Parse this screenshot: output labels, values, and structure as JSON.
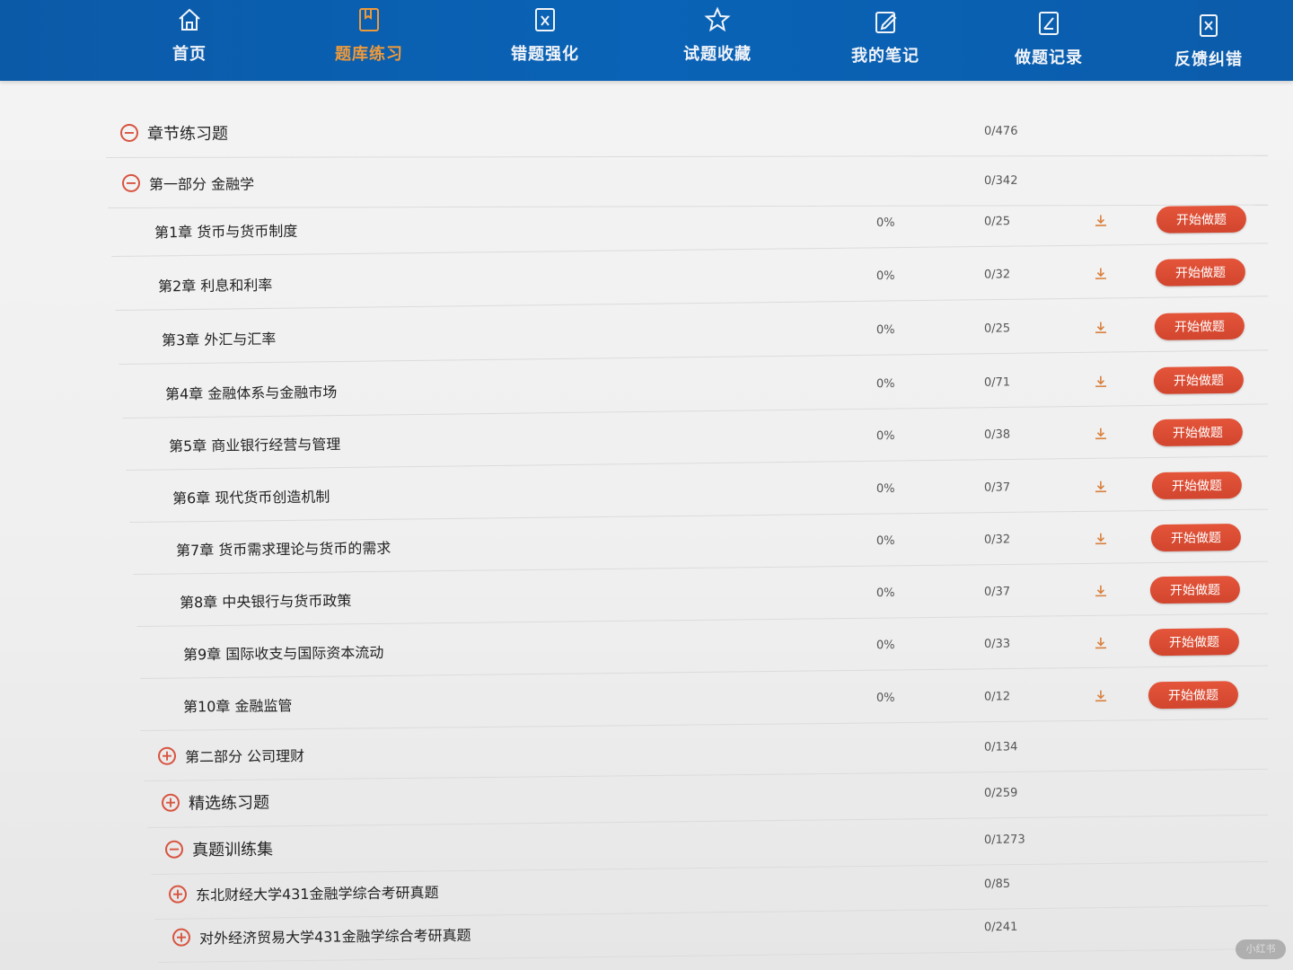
{
  "nav": [
    {
      "label": "首页",
      "icon": "home-icon"
    },
    {
      "label": "题库练习",
      "icon": "book-icon",
      "active": true
    },
    {
      "label": "错题强化",
      "icon": "wrong-icon"
    },
    {
      "label": "试题收藏",
      "icon": "star-icon"
    },
    {
      "label": "我的笔记",
      "icon": "note-icon"
    },
    {
      "label": "做题记录",
      "icon": "record-icon"
    },
    {
      "label": "反馈纠错",
      "icon": "feedback-icon"
    }
  ],
  "rows": [
    {
      "type": "section",
      "toggle": "−",
      "title": "章节练习题",
      "count": "0/476"
    },
    {
      "type": "part",
      "toggle": "−",
      "title": "第一部分 金融学",
      "count": "0/342"
    },
    {
      "type": "chapter",
      "title": "第1章 货币与货币制度",
      "pct": "0%",
      "count": "0/25",
      "button": "开始做题"
    },
    {
      "type": "chapter",
      "title": "第2章 利息和利率",
      "pct": "0%",
      "count": "0/32",
      "button": "开始做题"
    },
    {
      "type": "chapter",
      "title": "第3章 外汇与汇率",
      "pct": "0%",
      "count": "0/25",
      "button": "开始做题"
    },
    {
      "type": "chapter",
      "title": "第4章 金融体系与金融市场",
      "pct": "0%",
      "count": "0/71",
      "button": "开始做题"
    },
    {
      "type": "chapter",
      "title": "第5章 商业银行经营与管理",
      "pct": "0%",
      "count": "0/38",
      "button": "开始做题"
    },
    {
      "type": "chapter",
      "title": "第6章 现代货币创造机制",
      "pct": "0%",
      "count": "0/37",
      "button": "开始做题"
    },
    {
      "type": "chapter",
      "title": "第7章 货币需求理论与货币的需求",
      "pct": "0%",
      "count": "0/32",
      "button": "开始做题"
    },
    {
      "type": "chapter",
      "title": "第8章 中央银行与货币政策",
      "pct": "0%",
      "count": "0/37",
      "button": "开始做题"
    },
    {
      "type": "chapter",
      "title": "第9章 国际收支与国际资本流动",
      "pct": "0%",
      "count": "0/33",
      "button": "开始做题"
    },
    {
      "type": "chapter",
      "title": "第10章 金融监管",
      "pct": "0%",
      "count": "0/12",
      "button": "开始做题"
    },
    {
      "type": "part",
      "toggle": "+",
      "title": "第二部分 公司理财",
      "count": "0/134"
    },
    {
      "type": "section",
      "toggle": "+",
      "title": "精选练习题",
      "count": "0/259"
    },
    {
      "type": "section",
      "toggle": "−",
      "title": "真题训练集",
      "count": "0/1273"
    },
    {
      "type": "part",
      "toggle": "+",
      "title": "东北财经大学431金融学综合考研真题",
      "count": "0/85"
    },
    {
      "type": "part",
      "toggle": "+",
      "title": "对外经济贸易大学431金融学综合考研真题",
      "count": "0/241"
    }
  ],
  "watermark": "小红书"
}
